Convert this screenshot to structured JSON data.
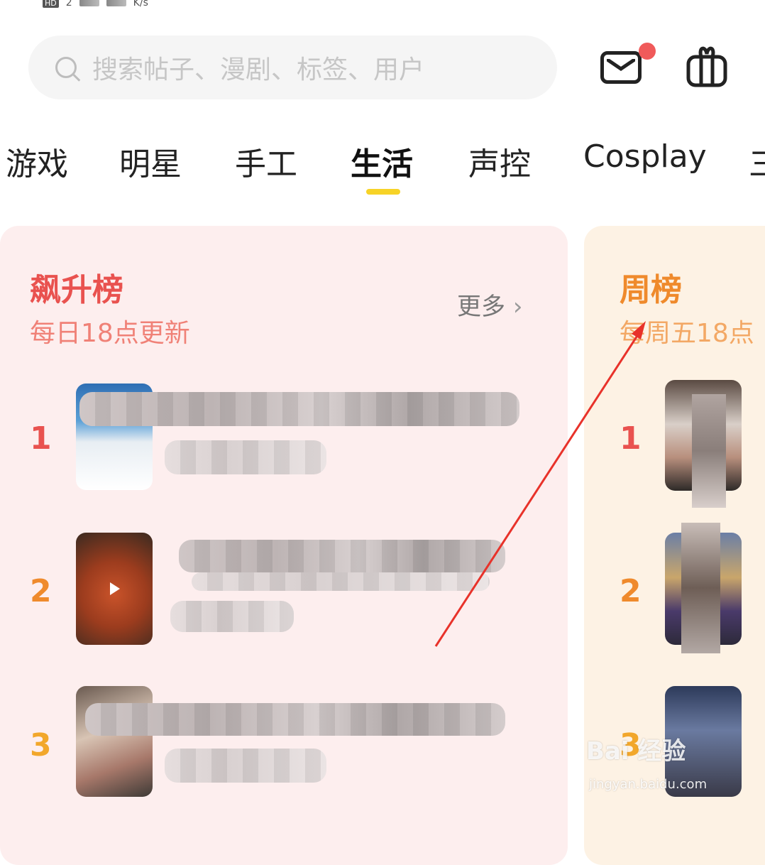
{
  "status_bar": {
    "hd_badge": "HD",
    "sim": "2",
    "speed_unit": "K/s"
  },
  "search": {
    "placeholder": "搜索帖子、漫剧、标签、用户"
  },
  "header_icons": [
    "mail-icon",
    "gift-icon"
  ],
  "tabs": [
    {
      "label": "游戏"
    },
    {
      "label": "明星"
    },
    {
      "label": "手工"
    },
    {
      "label": "生活",
      "active": true
    },
    {
      "label": "声控"
    },
    {
      "label": "Cosplay"
    },
    {
      "label": "三"
    }
  ],
  "rising_list": {
    "title": "飙升榜",
    "subtitle": "每日18点更新",
    "more_label": "更多",
    "items": [
      {
        "rank": "1"
      },
      {
        "rank": "2"
      },
      {
        "rank": "3"
      }
    ]
  },
  "weekly_list": {
    "title": "周榜",
    "subtitle": "每周五18点",
    "items": [
      {
        "rank": "1"
      },
      {
        "rank": "2"
      },
      {
        "rank": "3"
      }
    ]
  },
  "colors": {
    "accent_yellow": "#f7d327",
    "rising_red": "#e9524f",
    "weekly_orange": "#ef8a2c"
  },
  "watermark": {
    "brand": "Bai 经验",
    "url": "jingyan.baidu.com"
  }
}
